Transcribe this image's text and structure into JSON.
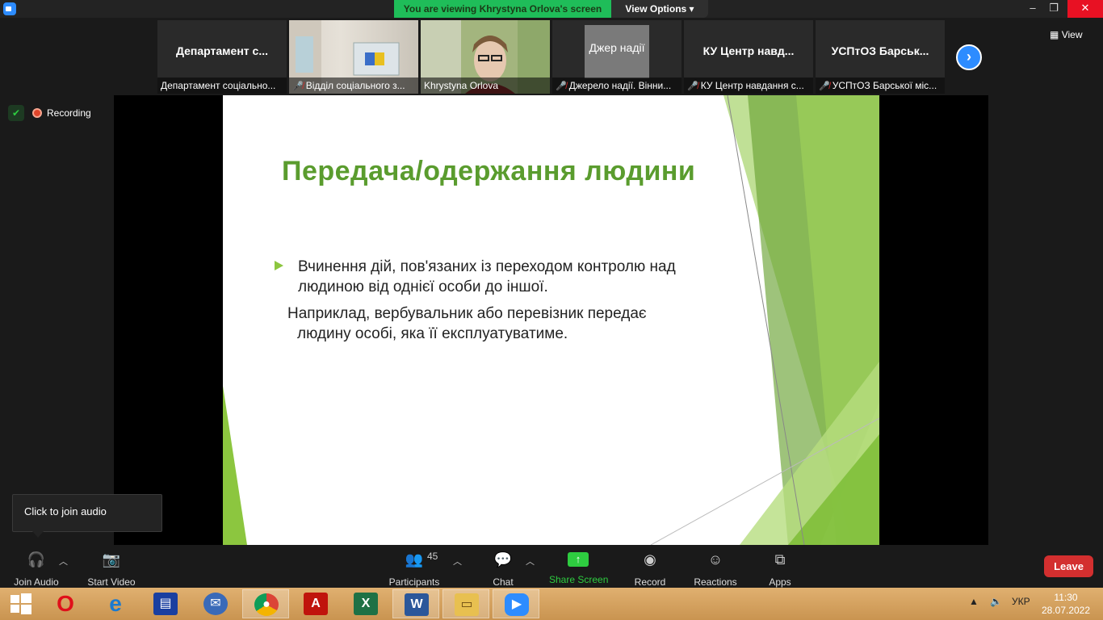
{
  "banner": {
    "viewing": "You are viewing Khrystyna Orlova's screen",
    "view_options": "View Options"
  },
  "window_controls": {
    "minimize": "–",
    "restore": "❐",
    "close": "✕"
  },
  "view_button": {
    "label": "View"
  },
  "participants_strip": [
    {
      "big": "Департамент с...",
      "caption": "Департамент соціально...",
      "muted": false,
      "active": false
    },
    {
      "big": "",
      "caption": "Відділ соціального з...",
      "muted": true,
      "active": false
    },
    {
      "big": "",
      "caption": "Khrystyna Orlova",
      "muted": false,
      "active": true
    },
    {
      "big": "",
      "caption": "Джерело надії. Вінни...",
      "muted": true,
      "active": false,
      "logo": "Джер надії"
    },
    {
      "big": "КУ Центр навд...",
      "caption": "КУ Центр навдання с...",
      "muted": true,
      "active": false
    },
    {
      "big": "УСПтОЗ Барськ...",
      "caption": "УСПтОЗ Барської міс...",
      "muted": true,
      "active": false
    }
  ],
  "status": {
    "recording": "Recording"
  },
  "slide": {
    "title": "Передача/одержання людини",
    "bullet_line1": "Вчинення дій, пов'язаних із переходом контролю над",
    "bullet_line2": "людиною від однієї особи до іншої.",
    "para_line1": "Наприклад, вербувальник або перевізник передає",
    "para_line2": "людину особі, яка її експлуатуватиме."
  },
  "tooltip": {
    "text": "Click to join audio"
  },
  "toolbar": {
    "join_audio": "Join Audio",
    "start_video": "Start Video",
    "participants": "Participants",
    "participants_count": "45",
    "chat": "Chat",
    "share_screen": "Share Screen",
    "record": "Record",
    "reactions": "Reactions",
    "apps": "Apps",
    "leave": "Leave"
  },
  "taskbar": {
    "apps": [
      "windows-start",
      "opera",
      "internet-explorer",
      "save-disk",
      "thunderbird",
      "chrome",
      "acrobat",
      "excel",
      "word",
      "file-explorer",
      "zoom"
    ],
    "language": "УКР",
    "time": "11:30",
    "date": "28.07.2022"
  },
  "colors": {
    "accent_green": "#5a9c2e",
    "zoom_blue": "#2d8cff",
    "leave_red": "#d32f2f",
    "share_green": "#2ecc40"
  }
}
